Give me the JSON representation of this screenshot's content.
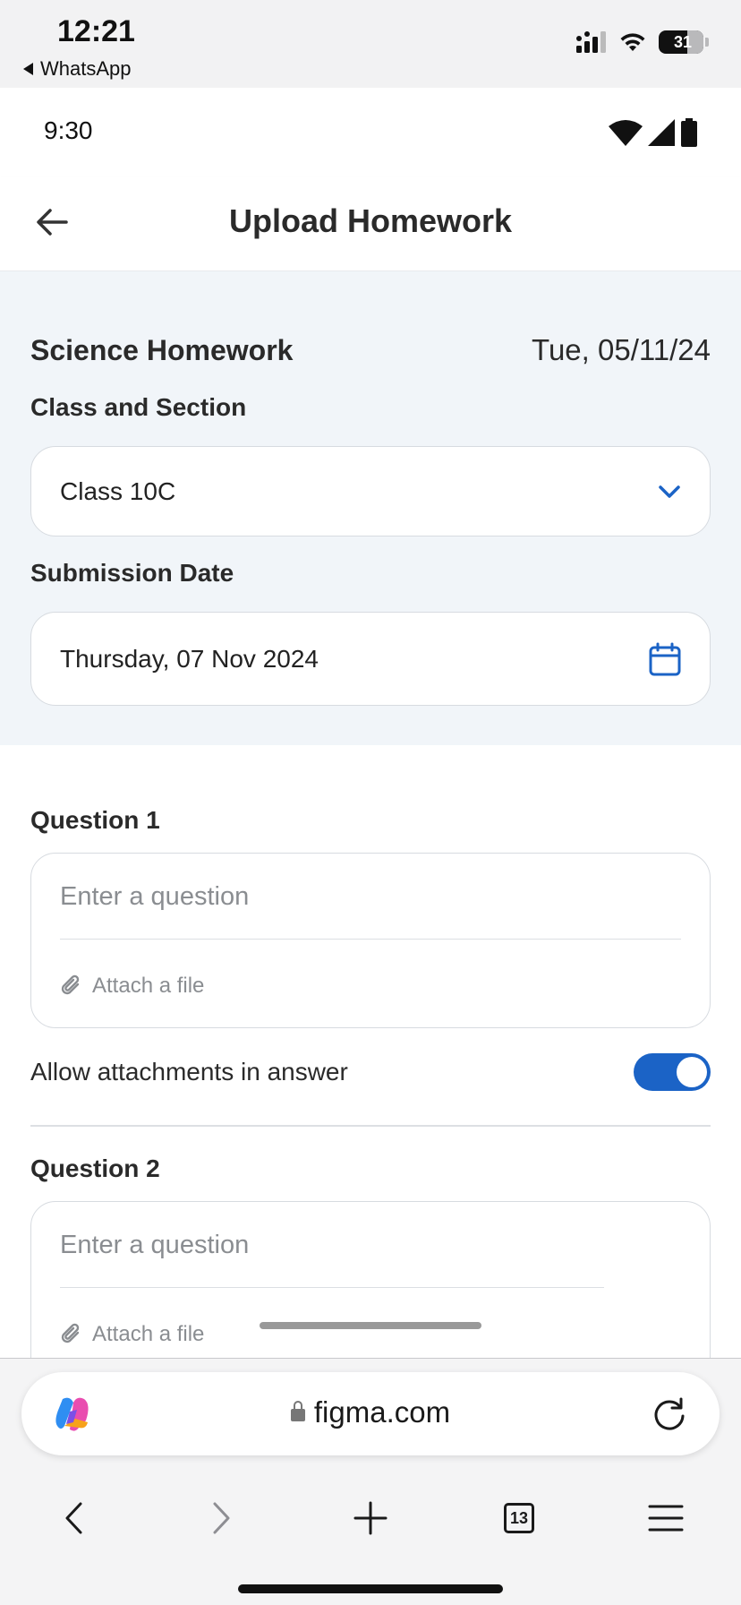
{
  "ios_status": {
    "time": "12:21",
    "back_app": "WhatsApp",
    "battery": "31"
  },
  "app": {
    "status_time": "9:30",
    "header_title": "Upload Homework",
    "homework_title": "Science Homework",
    "homework_date": "Tue, 05/11/24",
    "class_label": "Class and Section",
    "class_value": "Class 10C",
    "submission_label": "Submission Date",
    "submission_value": "Thursday, 07 Nov 2024",
    "questions": [
      {
        "label": "Question 1",
        "placeholder": "Enter a question",
        "attach": "Attach a file"
      },
      {
        "label": "Question 2",
        "placeholder": "Enter a question",
        "attach": "Attach a file"
      }
    ],
    "allow_attachments_label": "Allow attachments in answer",
    "allow_attachments_on": true,
    "accent_color": "#1b63c6"
  },
  "browser": {
    "url": "figma.com",
    "tab_count": "13"
  }
}
